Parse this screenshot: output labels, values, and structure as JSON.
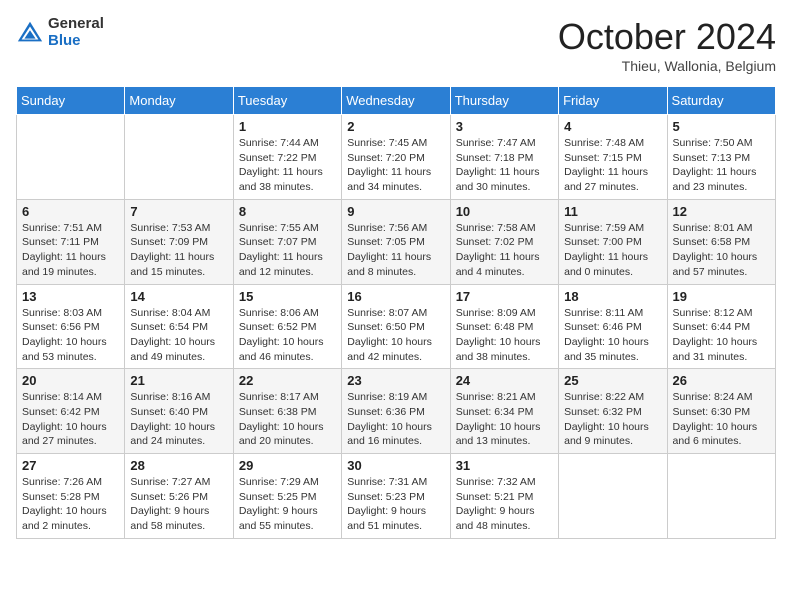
{
  "header": {
    "logo_general": "General",
    "logo_blue": "Blue",
    "month_title": "October 2024",
    "location": "Thieu, Wallonia, Belgium"
  },
  "weekdays": [
    "Sunday",
    "Monday",
    "Tuesday",
    "Wednesday",
    "Thursday",
    "Friday",
    "Saturday"
  ],
  "weeks": [
    [
      {
        "day": "",
        "info": ""
      },
      {
        "day": "",
        "info": ""
      },
      {
        "day": "1",
        "info": "Sunrise: 7:44 AM\nSunset: 7:22 PM\nDaylight: 11 hours and 38 minutes."
      },
      {
        "day": "2",
        "info": "Sunrise: 7:45 AM\nSunset: 7:20 PM\nDaylight: 11 hours and 34 minutes."
      },
      {
        "day": "3",
        "info": "Sunrise: 7:47 AM\nSunset: 7:18 PM\nDaylight: 11 hours and 30 minutes."
      },
      {
        "day": "4",
        "info": "Sunrise: 7:48 AM\nSunset: 7:15 PM\nDaylight: 11 hours and 27 minutes."
      },
      {
        "day": "5",
        "info": "Sunrise: 7:50 AM\nSunset: 7:13 PM\nDaylight: 11 hours and 23 minutes."
      }
    ],
    [
      {
        "day": "6",
        "info": "Sunrise: 7:51 AM\nSunset: 7:11 PM\nDaylight: 11 hours and 19 minutes."
      },
      {
        "day": "7",
        "info": "Sunrise: 7:53 AM\nSunset: 7:09 PM\nDaylight: 11 hours and 15 minutes."
      },
      {
        "day": "8",
        "info": "Sunrise: 7:55 AM\nSunset: 7:07 PM\nDaylight: 11 hours and 12 minutes."
      },
      {
        "day": "9",
        "info": "Sunrise: 7:56 AM\nSunset: 7:05 PM\nDaylight: 11 hours and 8 minutes."
      },
      {
        "day": "10",
        "info": "Sunrise: 7:58 AM\nSunset: 7:02 PM\nDaylight: 11 hours and 4 minutes."
      },
      {
        "day": "11",
        "info": "Sunrise: 7:59 AM\nSunset: 7:00 PM\nDaylight: 11 hours and 0 minutes."
      },
      {
        "day": "12",
        "info": "Sunrise: 8:01 AM\nSunset: 6:58 PM\nDaylight: 10 hours and 57 minutes."
      }
    ],
    [
      {
        "day": "13",
        "info": "Sunrise: 8:03 AM\nSunset: 6:56 PM\nDaylight: 10 hours and 53 minutes."
      },
      {
        "day": "14",
        "info": "Sunrise: 8:04 AM\nSunset: 6:54 PM\nDaylight: 10 hours and 49 minutes."
      },
      {
        "day": "15",
        "info": "Sunrise: 8:06 AM\nSunset: 6:52 PM\nDaylight: 10 hours and 46 minutes."
      },
      {
        "day": "16",
        "info": "Sunrise: 8:07 AM\nSunset: 6:50 PM\nDaylight: 10 hours and 42 minutes."
      },
      {
        "day": "17",
        "info": "Sunrise: 8:09 AM\nSunset: 6:48 PM\nDaylight: 10 hours and 38 minutes."
      },
      {
        "day": "18",
        "info": "Sunrise: 8:11 AM\nSunset: 6:46 PM\nDaylight: 10 hours and 35 minutes."
      },
      {
        "day": "19",
        "info": "Sunrise: 8:12 AM\nSunset: 6:44 PM\nDaylight: 10 hours and 31 minutes."
      }
    ],
    [
      {
        "day": "20",
        "info": "Sunrise: 8:14 AM\nSunset: 6:42 PM\nDaylight: 10 hours and 27 minutes."
      },
      {
        "day": "21",
        "info": "Sunrise: 8:16 AM\nSunset: 6:40 PM\nDaylight: 10 hours and 24 minutes."
      },
      {
        "day": "22",
        "info": "Sunrise: 8:17 AM\nSunset: 6:38 PM\nDaylight: 10 hours and 20 minutes."
      },
      {
        "day": "23",
        "info": "Sunrise: 8:19 AM\nSunset: 6:36 PM\nDaylight: 10 hours and 16 minutes."
      },
      {
        "day": "24",
        "info": "Sunrise: 8:21 AM\nSunset: 6:34 PM\nDaylight: 10 hours and 13 minutes."
      },
      {
        "day": "25",
        "info": "Sunrise: 8:22 AM\nSunset: 6:32 PM\nDaylight: 10 hours and 9 minutes."
      },
      {
        "day": "26",
        "info": "Sunrise: 8:24 AM\nSunset: 6:30 PM\nDaylight: 10 hours and 6 minutes."
      }
    ],
    [
      {
        "day": "27",
        "info": "Sunrise: 7:26 AM\nSunset: 5:28 PM\nDaylight: 10 hours and 2 minutes."
      },
      {
        "day": "28",
        "info": "Sunrise: 7:27 AM\nSunset: 5:26 PM\nDaylight: 9 hours and 58 minutes."
      },
      {
        "day": "29",
        "info": "Sunrise: 7:29 AM\nSunset: 5:25 PM\nDaylight: 9 hours and 55 minutes."
      },
      {
        "day": "30",
        "info": "Sunrise: 7:31 AM\nSunset: 5:23 PM\nDaylight: 9 hours and 51 minutes."
      },
      {
        "day": "31",
        "info": "Sunrise: 7:32 AM\nSunset: 5:21 PM\nDaylight: 9 hours and 48 minutes."
      },
      {
        "day": "",
        "info": ""
      },
      {
        "day": "",
        "info": ""
      }
    ]
  ]
}
